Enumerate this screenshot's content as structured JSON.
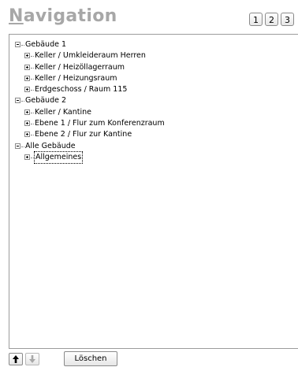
{
  "header": {
    "title_first_letter": "N",
    "title_rest": "avigation",
    "page_buttons": [
      "1",
      "2",
      "3"
    ]
  },
  "tree": {
    "nodes": [
      {
        "level": 0,
        "expanded": true,
        "label": "Gebäude 1"
      },
      {
        "level": 1,
        "expanded": false,
        "label": "Keller / Umkleideraum Herren"
      },
      {
        "level": 1,
        "expanded": false,
        "label": "Keller / Heizöllagerraum"
      },
      {
        "level": 1,
        "expanded": false,
        "label": "Keller / Heizungsraum"
      },
      {
        "level": 1,
        "expanded": false,
        "label": "Erdgeschoss / Raum 115"
      },
      {
        "level": 0,
        "expanded": true,
        "label": "Gebäude 2"
      },
      {
        "level": 1,
        "expanded": false,
        "label": "Keller / Kantine"
      },
      {
        "level": 1,
        "expanded": false,
        "label": "Ebene 1 / Flur zum Konferenzraum"
      },
      {
        "level": 1,
        "expanded": false,
        "label": "Ebene 2 / Flur zur Kantine"
      },
      {
        "level": 0,
        "expanded": true,
        "label": "Alle Gebäude"
      },
      {
        "level": 1,
        "expanded": false,
        "label": "Allgemeines",
        "selected": true
      }
    ]
  },
  "toolbar": {
    "move_up_icon": "arrow-up-icon",
    "move_down_icon": "arrow-down-icon",
    "delete_label": "Löschen"
  }
}
